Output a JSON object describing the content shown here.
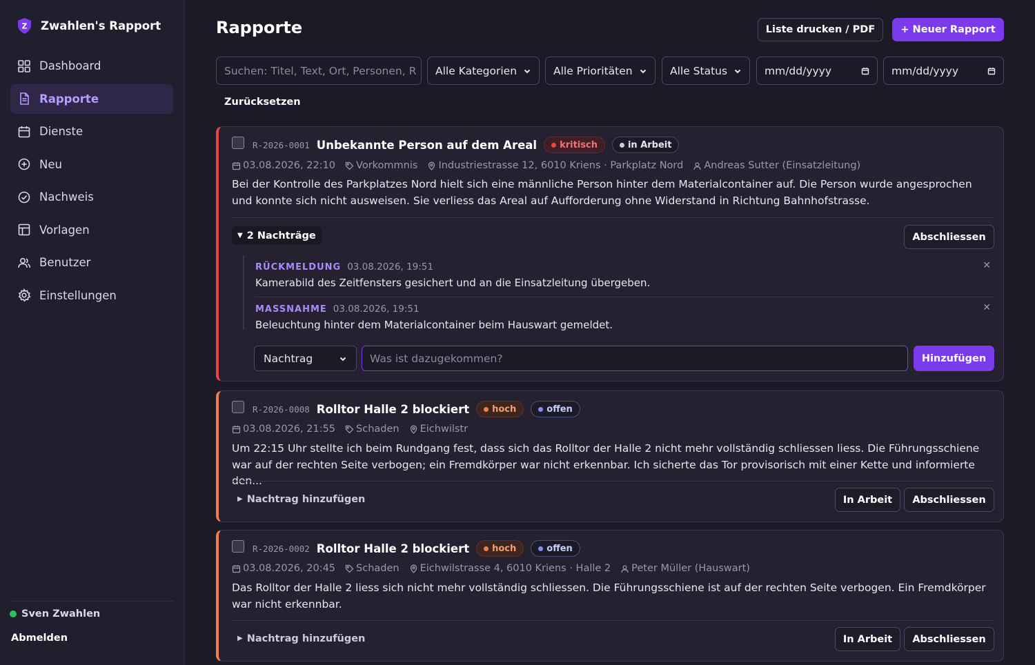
{
  "brand": {
    "name": "Zwahlen's Rapport",
    "logo_letter": "Z"
  },
  "nav": [
    {
      "label": "Dashboard",
      "icon": "dashboard-icon"
    },
    {
      "label": "Rapporte",
      "icon": "file-icon",
      "active": true
    },
    {
      "label": "Dienste",
      "icon": "calendar-icon"
    },
    {
      "label": "Neu",
      "icon": "plus-circle-icon"
    },
    {
      "label": "Nachweis",
      "icon": "check-circle-icon"
    },
    {
      "label": "Vorlagen",
      "icon": "template-icon"
    },
    {
      "label": "Benutzer",
      "icon": "users-icon"
    },
    {
      "label": "Einstellungen",
      "icon": "gear-icon"
    }
  ],
  "user": {
    "name": "Sven Zwahlen",
    "logout": "Abmelden",
    "status_color": "#22c55e"
  },
  "header": {
    "title": "Rapporte",
    "print_label": "Liste drucken / PDF",
    "new_label": "+ Neuer Rapport"
  },
  "filters": {
    "search_placeholder": "Suchen: Titel, Text, Ort, Personen, R",
    "category": "Alle Kategorien",
    "priority": "Alle Prioritäten",
    "status": "Alle Status",
    "date_from": "mm/dd/yyyy",
    "date_to": "mm/dd/yyyy",
    "reset": "Zurücksetzen"
  },
  "reports": [
    {
      "id": "R-2026-0001",
      "title": "Unbekannte Person auf dem Areal",
      "priority": "kritisch",
      "status": "in Arbeit",
      "datetime": "03.08.2026, 22:10",
      "category": "Vorkommnis",
      "location": "Industriestrasse 12, 6010 Kriens · Parkplatz Nord",
      "person": "Andreas Sutter (Einsatzleitung)",
      "text": "Bei der Kontrolle des Parkplatzes Nord hielt sich eine männliche Person hinter dem Materialcontainer auf. Die Person wurde angesprochen und konnte sich nicht ausweisen. Sie verliess das Areal auf Aufforderung ohne Widerstand in Richtung Bahnhofstrasse.",
      "toggle_label": "2 Nachträge",
      "close_label": "Abschliessen",
      "addenda": [
        {
          "type": "RÜCKMELDUNG",
          "date": "03.08.2026, 19:51",
          "text": "Kamerabild des Zeitfensters gesichert und an die Einsatzleitung übergeben."
        },
        {
          "type": "MASSNAHME",
          "date": "03.08.2026, 19:51",
          "text": "Beleuchtung hinter dem Materialcontainer beim Hauswart gemeldet."
        }
      ],
      "addendum_form": {
        "type": "Nachtrag",
        "placeholder": "Was ist dazugekommen?",
        "submit": "Hinzufügen"
      }
    },
    {
      "id": "R-2026-0008",
      "title": "Rolltor Halle 2 blockiert",
      "priority": "hoch",
      "status": "offen",
      "datetime": "03.08.2026, 21:55",
      "category": "Schaden",
      "location": "Eichwilstr",
      "text": "Um 22:15 Uhr stellte ich beim Rundgang fest, dass sich das Rolltor der Halle 2 nicht mehr vollständig schliessen liess. Die Führungsschiene war auf der rechten Seite verbogen; ein Fremdkörper war nicht erkennbar. Ich sicherte das Tor provisorisch mit einer Kette und informierte den...",
      "toggle_label": "Nachtrag hinzufügen",
      "in_progress_label": "In Arbeit",
      "close_label": "Abschliessen"
    },
    {
      "id": "R-2026-0002",
      "title": "Rolltor Halle 2 blockiert",
      "priority": "hoch",
      "status": "offen",
      "datetime": "03.08.2026, 20:45",
      "category": "Schaden",
      "location": "Eichwilstrasse 4, 6010 Kriens · Halle 2",
      "person": "Peter Müller (Hauswart)",
      "text": "Das Rolltor der Halle 2 liess sich nicht mehr vollständig schliessen. Die Führungsschiene ist auf der rechten Seite verbogen. Ein Fremdkörper war nicht erkennbar.",
      "toggle_label": "Nachtrag hinzufügen",
      "in_progress_label": "In Arbeit",
      "close_label": "Abschliessen"
    }
  ],
  "colors": {
    "accent": "#7c3aed",
    "critical": "#ef4444",
    "high": "#f0804a"
  }
}
